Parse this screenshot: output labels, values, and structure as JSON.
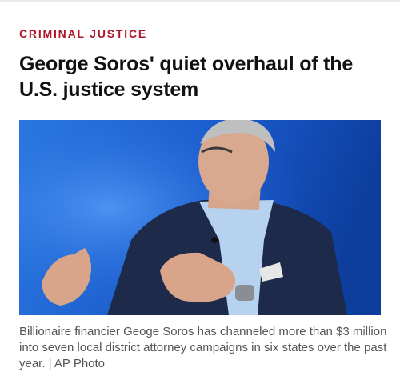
{
  "article": {
    "section": "CRIMINAL JUSTICE",
    "headline": "George Soros' quiet overhaul of the U.S. justice system",
    "caption": "Billionaire financier Geoge Soros has channeled more than $3 million into seven local district attorney campaigns in six states over the past year. | AP Photo"
  },
  "colors": {
    "section_accent": "#b0152b",
    "photo_background": "#1a64d4"
  }
}
